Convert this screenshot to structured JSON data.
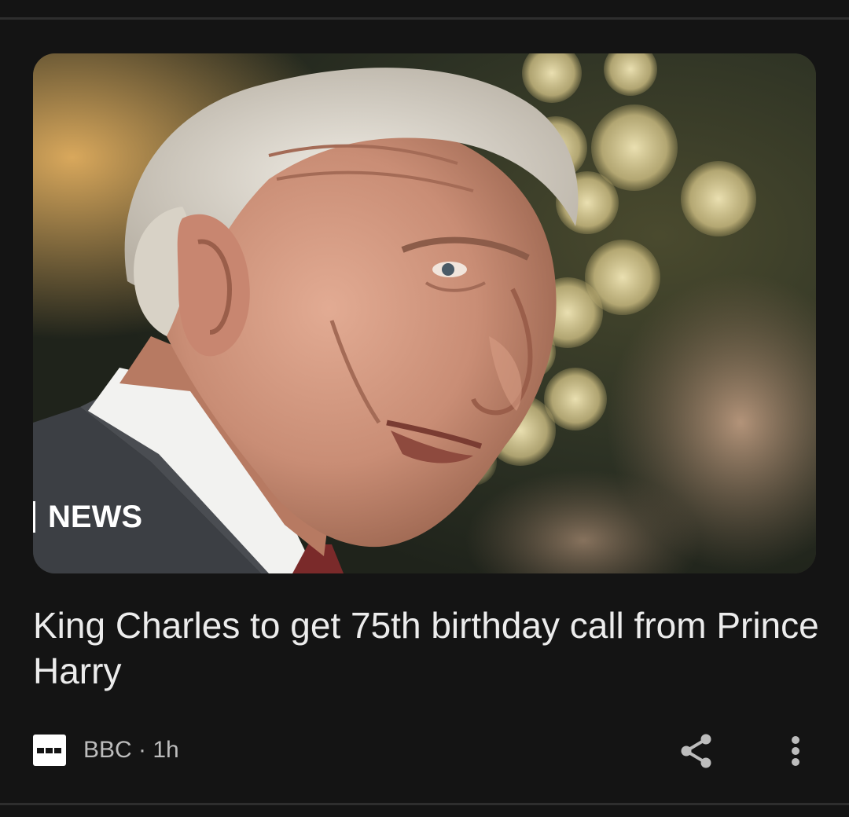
{
  "article": {
    "image_badge": "NEWS",
    "headline": "King Charles to get 75th birthday call from Prince Harry",
    "source": "BBC",
    "separator": "·",
    "time": "1h"
  },
  "icons": {
    "source_logo": "bbc-logo-icon",
    "share": "share-icon",
    "more": "more-vert-icon"
  },
  "colors": {
    "background": "#141414",
    "headline": "#ececec",
    "meta": "#bdbdbd",
    "icon": "#bdbdbd",
    "divider": "#2e2e2e"
  }
}
